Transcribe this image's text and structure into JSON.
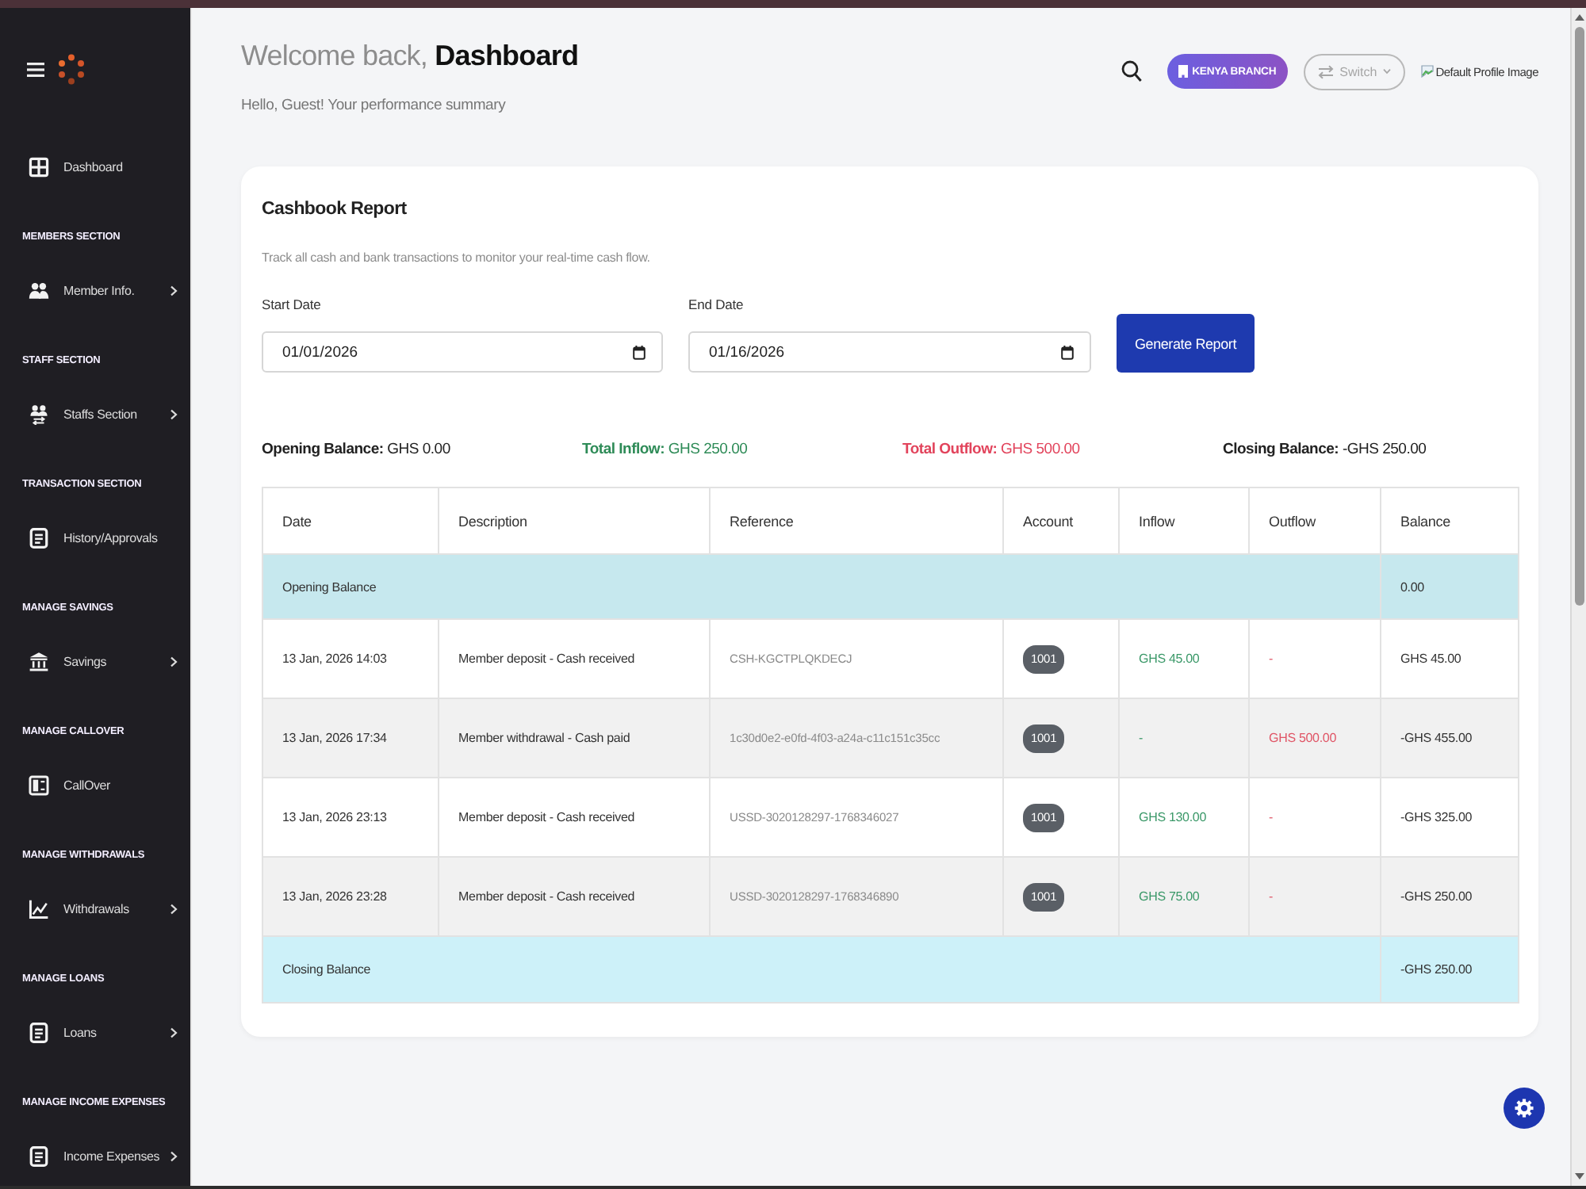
{
  "sidebar": {
    "items": [
      {
        "kind": "link",
        "label": "Dashboard",
        "expandable": false
      },
      {
        "kind": "heading",
        "label": "MEMBERS SECTION"
      },
      {
        "kind": "link",
        "label": "Member Info.",
        "expandable": true
      },
      {
        "kind": "heading",
        "label": "STAFF SECTION"
      },
      {
        "kind": "link",
        "label": "Staffs Section",
        "expandable": true
      },
      {
        "kind": "heading",
        "label": "TRANSACTION SECTION"
      },
      {
        "kind": "link",
        "label": "History/Approvals",
        "expandable": false
      },
      {
        "kind": "heading",
        "label": "MANAGE SAVINGS"
      },
      {
        "kind": "link",
        "label": "Savings",
        "expandable": true
      },
      {
        "kind": "heading",
        "label": "MANAGE CALLOVER"
      },
      {
        "kind": "link",
        "label": "CallOver",
        "expandable": false
      },
      {
        "kind": "heading",
        "label": "MANAGE WITHDRAWALS"
      },
      {
        "kind": "link",
        "label": "Withdrawals",
        "expandable": true
      },
      {
        "kind": "heading",
        "label": "MANAGE LOANS"
      },
      {
        "kind": "link",
        "label": "Loans",
        "expandable": true
      },
      {
        "kind": "heading",
        "label": "MANAGE INCOME EXPENSES"
      },
      {
        "kind": "link",
        "label": "Income Expenses",
        "expandable": true
      }
    ]
  },
  "header": {
    "title": "Welcome back, **Dashboard**",
    "subtitle": "Hello, Guest! Your performance summary",
    "branch": "KENYA BRANCH",
    "switch": "Switch",
    "profile_image_alt": "Default Profile Image"
  },
  "report": {
    "title": "Cashbook Report",
    "description": "Track all cash and bank transactions to monitor your real-time cash flow.",
    "fields": [
      {
        "label": "Start Date",
        "value": "01/01/2026"
      },
      {
        "label": "End Date",
        "value": "01/16/2026"
      }
    ],
    "button": "Generate Report",
    "summary": [
      {
        "label": "Opening Balance:",
        "value": "GHS 0.00",
        "color": "#222222"
      },
      {
        "label": "Total Inflow:",
        "value": "GHS 250.00",
        "color": "#2e8b57"
      },
      {
        "label": "Total Outflow:",
        "value": "GHS 500.00",
        "color": "#e2445c"
      },
      {
        "label": "Closing Balance:",
        "value": "-GHS 250.00",
        "color": "#222222"
      }
    ],
    "table": {
      "columns": [
        "Date",
        "Description",
        "Reference",
        "Account",
        "Inflow",
        "Outflow",
        "Balance"
      ],
      "rows": [
        {
          "kind": "opening",
          "label": "Opening Balance",
          "balance": "0.00"
        },
        {
          "kind": "entry",
          "date": "13 Jan, 2026 14:03",
          "description": "Member deposit - Cash received",
          "reference": "CSH-KGCTPLQKDECJ",
          "account": "1001",
          "inflow": "GHS 45.00",
          "outflow": "-",
          "balance": "GHS 45.00"
        },
        {
          "kind": "entry",
          "date": "13 Jan, 2026 17:34",
          "description": "Member withdrawal - Cash paid",
          "reference": "1c30d0e2-e0fd-4f03-a24a-c11c151c35cc",
          "account": "1001",
          "inflow": "-",
          "outflow": "GHS 500.00",
          "balance": "-GHS 455.00"
        },
        {
          "kind": "entry",
          "date": "13 Jan, 2026 23:13",
          "description": "Member deposit - Cash received",
          "reference": "USSD-3020128297-1768346027",
          "account": "1001",
          "inflow": "GHS 130.00",
          "outflow": "-",
          "balance": "-GHS 325.00"
        },
        {
          "kind": "entry",
          "date": "13 Jan, 2026 23:28",
          "description": "Member deposit - Cash received",
          "reference": "USSD-3020128297-1768346890",
          "account": "1001",
          "inflow": "GHS 75.00",
          "outflow": "-",
          "balance": "-GHS 250.00"
        },
        {
          "kind": "closing",
          "label": "Closing Balance",
          "balance": "-GHS 250.00"
        }
      ]
    }
  }
}
